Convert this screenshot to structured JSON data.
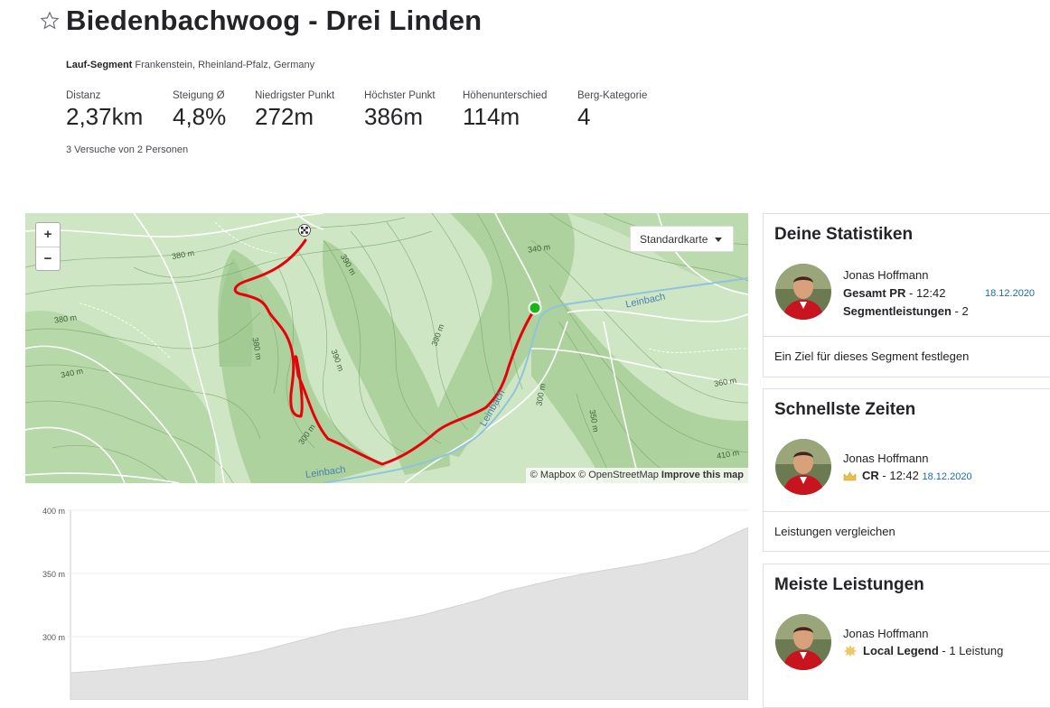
{
  "header": {
    "title": "Biedenbachwoog - Drei Linden",
    "segment_type": "Lauf-Segment",
    "location": "Frankenstein, Rheinland-Pfalz, Germany",
    "stats": [
      {
        "label": "Distanz",
        "value": "2,37km"
      },
      {
        "label": "Steigung Ø",
        "value": "4,8%"
      },
      {
        "label": "Niedrigster Punkt",
        "value": "272m"
      },
      {
        "label": "Höchster Punkt",
        "value": "386m"
      },
      {
        "label": "Höhenunterschied",
        "value": "114m"
      },
      {
        "label": "Berg-Kategorie",
        "value": "4"
      }
    ],
    "attempts": "3 Versuche von 2 Personen"
  },
  "map": {
    "zoom_in": "+",
    "zoom_out": "−",
    "map_type": "Standardkarte",
    "attribution_mapbox": "© Mapbox",
    "attribution_osm": "© OpenStreetMap",
    "attribution_improve": "Improve this map",
    "contour_labels": [
      "380 m",
      "380 m",
      "340 m",
      "390 m",
      "380 m",
      "390 m",
      "390 m",
      "300 m",
      "300 m",
      "340 m",
      "360 m",
      "350 m",
      "410 m"
    ],
    "water_labels": [
      "Leinbach",
      "Leinbach",
      "Leinbach"
    ],
    "route_color": "#e8000b",
    "start_color": "#1bb514"
  },
  "elevation": {
    "y_ticks": [
      "400 m",
      "350 m",
      "300 m"
    ]
  },
  "panels": {
    "stats": {
      "title": "Deine Statistiken",
      "name": "Jonas Hoffmann",
      "pr_label": "Gesamt PR",
      "pr_value": "- 12:42",
      "pr_date": "18.12.2020",
      "efforts_label": "Segmentleistungen",
      "efforts_value": "- 2",
      "link": "Ein Ziel für dieses Segment festlegen"
    },
    "fastest": {
      "title": "Schnellste Zeiten",
      "name": "Jonas Hoffmann",
      "cr_label": "CR",
      "cr_value": "- 12:42",
      "cr_date": "18.12.2020",
      "link": "Leistungen vergleichen"
    },
    "most": {
      "title": "Meiste Leistungen",
      "name": "Jonas Hoffmann",
      "ll_label": "Local Legend",
      "ll_value": "- 1 Leistung"
    }
  },
  "colors": {
    "date_blue": "#1d6aa5",
    "crown_gold": "#e8c04a"
  }
}
